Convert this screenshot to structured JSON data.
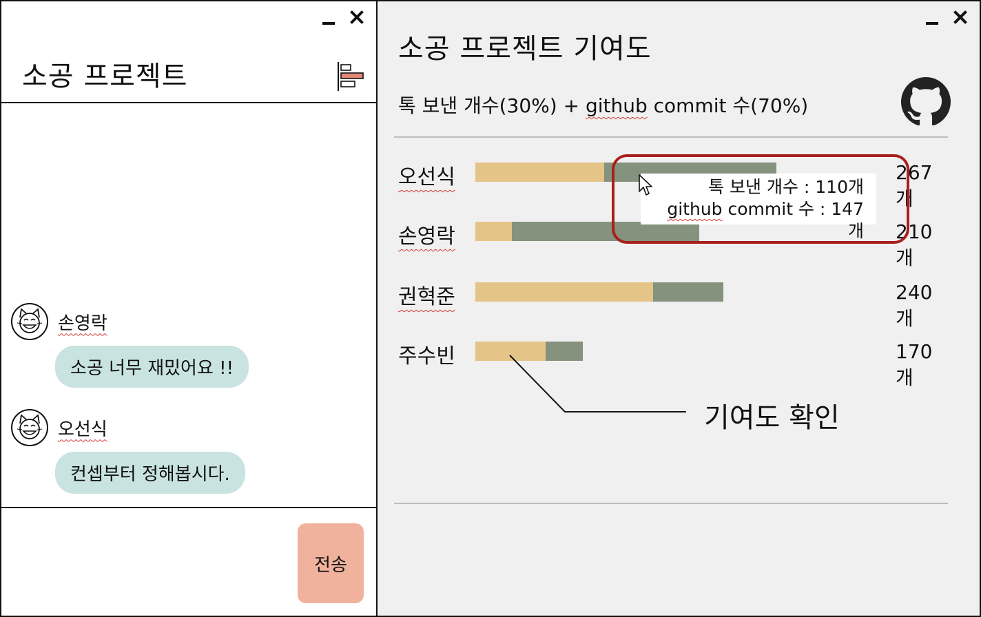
{
  "chat_window": {
    "title": "소공 프로젝트",
    "messages": [
      {
        "sender": "손영락",
        "text": "소공 너무 재밌어요 !!"
      },
      {
        "sender": "오선식",
        "text": "컨셉부터 정해봅시다."
      }
    ],
    "send_label": "전송"
  },
  "stats_window": {
    "title": "소공 프로젝트 기여도",
    "subtitle_prefix": "톡 보낸 개수(30%) + ",
    "subtitle_github": "github",
    "subtitle_suffix": " commit 수(70%)",
    "members": [
      {
        "name": "오선식",
        "messages": 110,
        "commits": 147,
        "total_label": "267개"
      },
      {
        "name": "손영락",
        "messages": 31,
        "commits": 160,
        "total_label": "210개"
      },
      {
        "name": "권혁준",
        "messages": 152,
        "commits": 60,
        "total_label": "240개"
      },
      {
        "name": "주수빈",
        "messages": 60,
        "commits": 32,
        "total_label": "170개"
      }
    ],
    "tooltip": {
      "line1": "톡 보낸 개수 : 110개",
      "line2_github": "github",
      "line2_rest": " commit 수 : 147개"
    },
    "callout": "기여도 확인"
  },
  "colors": {
    "message_segment": "#e5c487",
    "commit_segment": "#84927e",
    "chat_bubble": "#c9e3e0",
    "send_button": "#f0b29c",
    "highlight_border": "#a8201c",
    "stats_background": "#f0f0f0"
  },
  "icons": [
    "minimize-icon",
    "close-icon",
    "bar-chart-icon",
    "cat-avatar-icon",
    "github-icon",
    "mouse-cursor-icon"
  ]
}
